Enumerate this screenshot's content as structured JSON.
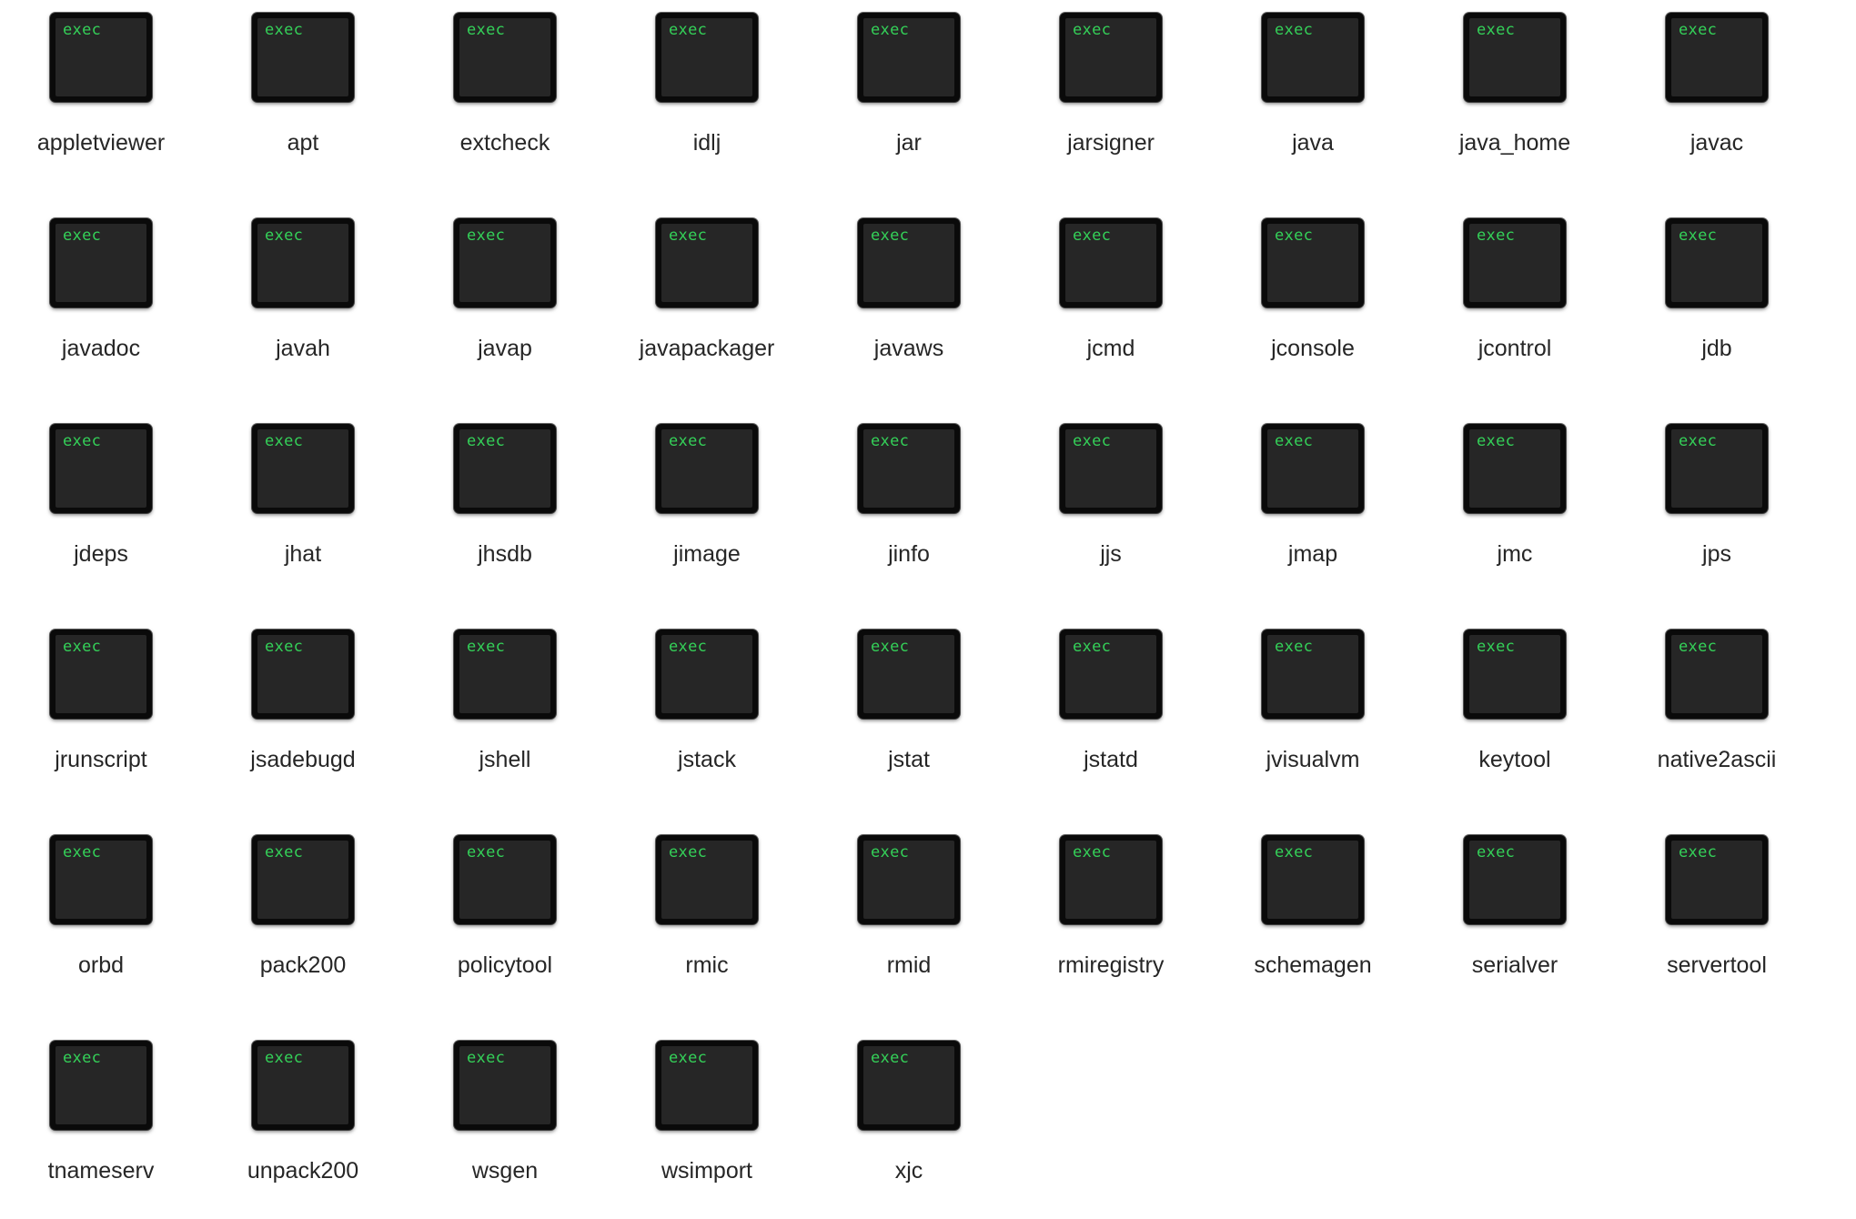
{
  "icon_badge": "exec",
  "colors": {
    "background": "#ffffff",
    "icon_body": "#0a0a0a",
    "icon_screen": "#262626",
    "exec_text": "#34d058",
    "label_text": "#262626"
  },
  "files": [
    {
      "name": "appletviewer",
      "icon": "terminal-exec-icon"
    },
    {
      "name": "apt",
      "icon": "terminal-exec-icon"
    },
    {
      "name": "extcheck",
      "icon": "terminal-exec-icon"
    },
    {
      "name": "idlj",
      "icon": "terminal-exec-icon"
    },
    {
      "name": "jar",
      "icon": "terminal-exec-icon"
    },
    {
      "name": "jarsigner",
      "icon": "terminal-exec-icon"
    },
    {
      "name": "java",
      "icon": "terminal-exec-icon"
    },
    {
      "name": "java_home",
      "icon": "terminal-exec-icon"
    },
    {
      "name": "javac",
      "icon": "terminal-exec-icon"
    },
    {
      "name": "javadoc",
      "icon": "terminal-exec-icon"
    },
    {
      "name": "javah",
      "icon": "terminal-exec-icon"
    },
    {
      "name": "javap",
      "icon": "terminal-exec-icon"
    },
    {
      "name": "javapackager",
      "icon": "terminal-exec-icon"
    },
    {
      "name": "javaws",
      "icon": "terminal-exec-icon"
    },
    {
      "name": "jcmd",
      "icon": "terminal-exec-icon"
    },
    {
      "name": "jconsole",
      "icon": "terminal-exec-icon"
    },
    {
      "name": "jcontrol",
      "icon": "terminal-exec-icon"
    },
    {
      "name": "jdb",
      "icon": "terminal-exec-icon"
    },
    {
      "name": "jdeps",
      "icon": "terminal-exec-icon"
    },
    {
      "name": "jhat",
      "icon": "terminal-exec-icon"
    },
    {
      "name": "jhsdb",
      "icon": "terminal-exec-icon"
    },
    {
      "name": "jimage",
      "icon": "terminal-exec-icon"
    },
    {
      "name": "jinfo",
      "icon": "terminal-exec-icon"
    },
    {
      "name": "jjs",
      "icon": "terminal-exec-icon"
    },
    {
      "name": "jmap",
      "icon": "terminal-exec-icon"
    },
    {
      "name": "jmc",
      "icon": "terminal-exec-icon"
    },
    {
      "name": "jps",
      "icon": "terminal-exec-icon"
    },
    {
      "name": "jrunscript",
      "icon": "terminal-exec-icon"
    },
    {
      "name": "jsadebugd",
      "icon": "terminal-exec-icon"
    },
    {
      "name": "jshell",
      "icon": "terminal-exec-icon"
    },
    {
      "name": "jstack",
      "icon": "terminal-exec-icon"
    },
    {
      "name": "jstat",
      "icon": "terminal-exec-icon"
    },
    {
      "name": "jstatd",
      "icon": "terminal-exec-icon"
    },
    {
      "name": "jvisualvm",
      "icon": "terminal-exec-icon"
    },
    {
      "name": "keytool",
      "icon": "terminal-exec-icon"
    },
    {
      "name": "native2ascii",
      "icon": "terminal-exec-icon"
    },
    {
      "name": "orbd",
      "icon": "terminal-exec-icon"
    },
    {
      "name": "pack200",
      "icon": "terminal-exec-icon"
    },
    {
      "name": "policytool",
      "icon": "terminal-exec-icon"
    },
    {
      "name": "rmic",
      "icon": "terminal-exec-icon"
    },
    {
      "name": "rmid",
      "icon": "terminal-exec-icon"
    },
    {
      "name": "rmiregistry",
      "icon": "terminal-exec-icon"
    },
    {
      "name": "schemagen",
      "icon": "terminal-exec-icon"
    },
    {
      "name": "serialver",
      "icon": "terminal-exec-icon"
    },
    {
      "name": "servertool",
      "icon": "terminal-exec-icon"
    },
    {
      "name": "tnameserv",
      "icon": "terminal-exec-icon"
    },
    {
      "name": "unpack200",
      "icon": "terminal-exec-icon"
    },
    {
      "name": "wsgen",
      "icon": "terminal-exec-icon"
    },
    {
      "name": "wsimport",
      "icon": "terminal-exec-icon"
    },
    {
      "name": "xjc",
      "icon": "terminal-exec-icon"
    }
  ]
}
